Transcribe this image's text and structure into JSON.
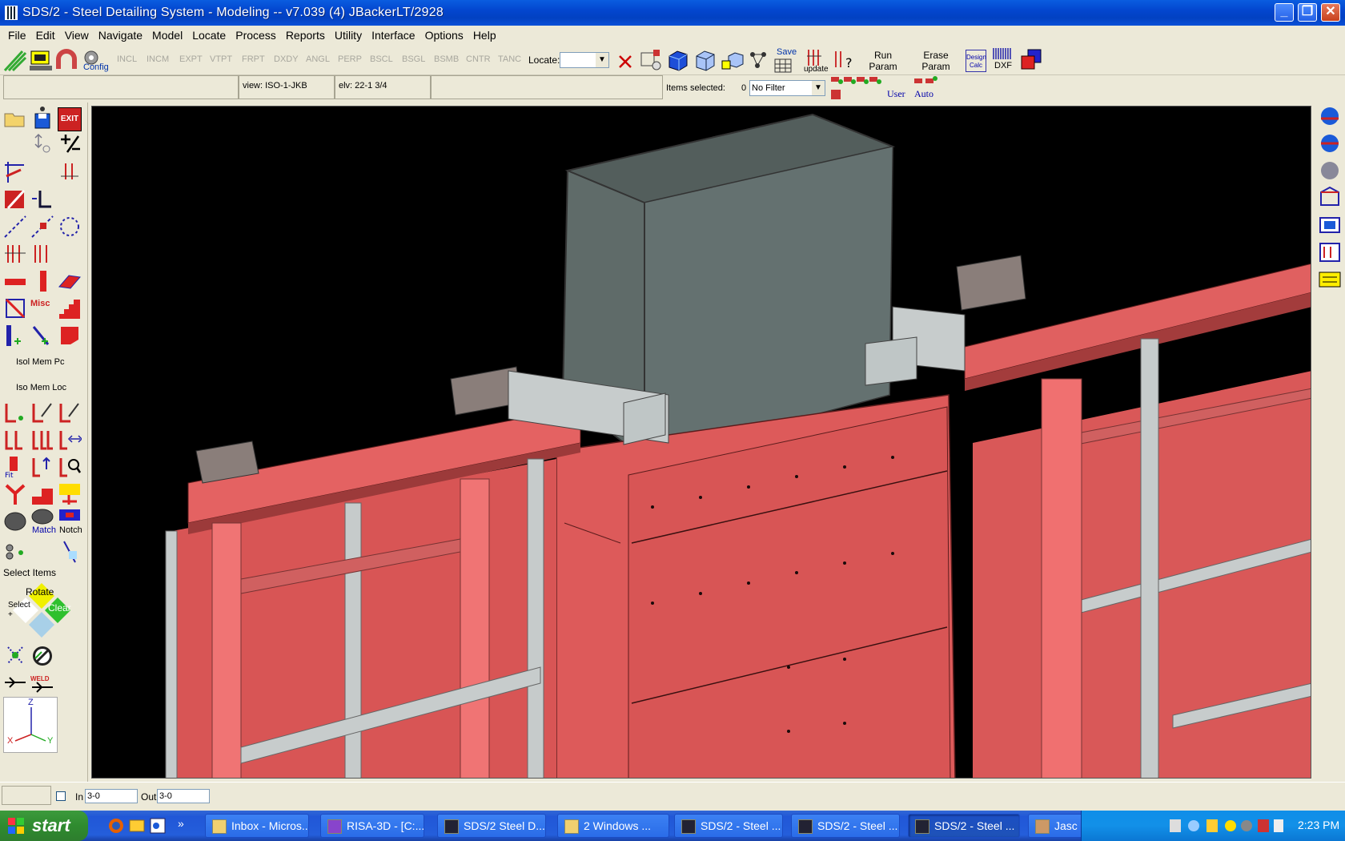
{
  "window": {
    "title": "SDS/2 - Steel Detailing System - Modeling  --  v7.039  (4) JBackerLT/2928",
    "minimize": "_",
    "maximize": "❐",
    "close": "✕"
  },
  "menu": [
    "File",
    "Edit",
    "View",
    "Navigate",
    "Model",
    "Locate",
    "Process",
    "Reports",
    "Utility",
    "Interface",
    "Options",
    "Help"
  ],
  "toolbar": {
    "config_label": "Config",
    "locate_modes": [
      "INCL",
      "INCM",
      "EXPT",
      "VTPT",
      "FRPT",
      "DXDY",
      "ANGL",
      "PERP",
      "BSCL",
      "BSGL",
      "BSMB",
      "CNTR",
      "TANC"
    ],
    "locate_label": "Locate:",
    "save_label": "Save",
    "update_label": "update",
    "run_param_label": "Run Param",
    "erase_param_label": "Erase Param",
    "design_calc_label": "Design Calc",
    "dxf_label": "DXF"
  },
  "toolbar2": {
    "view_text": "view: ISO-1-JKB",
    "elev_text": "elv: 22-1 3/4",
    "items_selected_label": "Items selected:",
    "items_selected_count": "0",
    "filter_value": "No Filter",
    "user_label": "User",
    "auto_label": "Auto"
  },
  "left_palette": {
    "isol_mem_pc": "Isol Mem Pc",
    "iso_mem_loc": "Iso Mem Loc",
    "match_label": "Match",
    "notch_label": "Notch",
    "select_items": "Select Items",
    "rotate": "Rotate",
    "select": "Select",
    "plus": "+",
    "clear": "Clear",
    "exit_label": "EXIT",
    "misc_label": "Misc",
    "weld_label": "WELD",
    "axis_z": "Z",
    "axis_x": "X",
    "axis_y": "Y"
  },
  "statusbar": {
    "in_label": "In",
    "in_value": "3-0",
    "out_label": "Out",
    "out_value": "3-0"
  },
  "taskbar": {
    "start": "start",
    "buttons": [
      "Inbox - Micros...",
      "RISA-3D - [C:...",
      "SDS/2 Steel D...",
      "2 Windows ...",
      "SDS/2 - Steel ...",
      "SDS/2 - Steel ...",
      "SDS/2 - Steel ...",
      "Jasc Paint Sh..."
    ],
    "clock": "2:23 PM"
  },
  "colors": {
    "steel_red": "#d95555",
    "steel_gray": "#5d6866",
    "background": "#000000"
  }
}
